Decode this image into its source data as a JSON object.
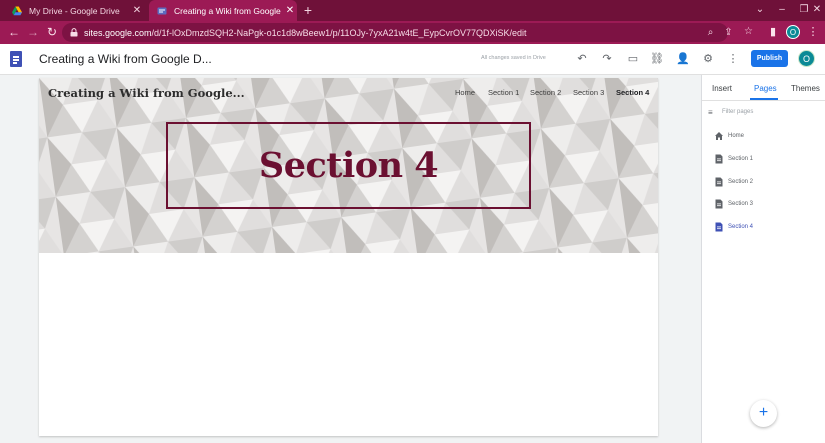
{
  "browser": {
    "tabs": [
      {
        "title": "My Drive - Google Drive",
        "active": false
      },
      {
        "title": "Creating a Wiki from Google Do",
        "active": true
      }
    ],
    "url_host": "sites.google.com",
    "url_path": "/d/1f-lOxDmzdSQH2-NaPgk-o1c1d8wBeew1/p/11OJy-7yxA21w4tE_EypCvrOV77QDXiSK/edit",
    "profile_initial": "O"
  },
  "app": {
    "doc_title": "Creating a Wiki from Google D...",
    "saved_status": "All changes saved in Drive",
    "publish_label": "Publish",
    "profile_initial": "O",
    "accent": "#1a73e8"
  },
  "site": {
    "name": "Creating a Wiki from Google...",
    "nav": [
      "Home",
      "Section 1",
      "Section 2",
      "Section 3",
      "Section 4"
    ],
    "current_nav": "Section 4",
    "page_title": "Section 4",
    "title_color": "#6b1031"
  },
  "panel": {
    "tabs": [
      "Insert",
      "Pages",
      "Themes"
    ],
    "active_tab": "Pages",
    "filter_placeholder": "Filter pages",
    "pages": [
      {
        "label": "Home",
        "icon": "home-icon"
      },
      {
        "label": "Section 1",
        "icon": "page-icon"
      },
      {
        "label": "Section 2",
        "icon": "page-icon"
      },
      {
        "label": "Section 3",
        "icon": "page-icon"
      },
      {
        "label": "Section 4",
        "icon": "page-icon",
        "selected": true
      }
    ],
    "fab_label": "+"
  }
}
